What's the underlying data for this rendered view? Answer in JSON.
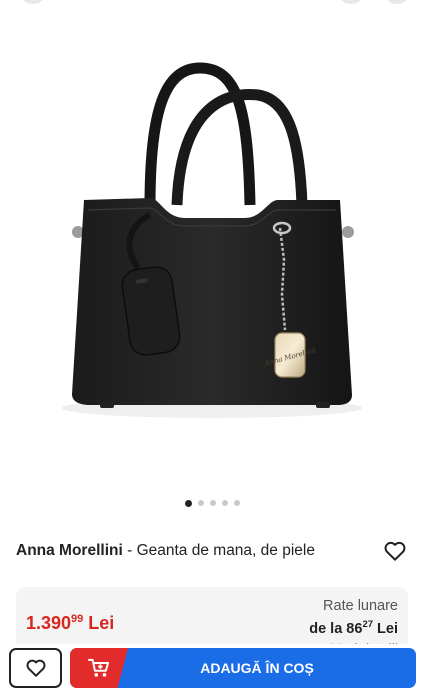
{
  "product": {
    "brand": "Anna Morellini",
    "separator": " - ",
    "name": "Geanta de mana, de piele",
    "image_icon": "handbag-product-photo",
    "charm_text": "Anna Morellini"
  },
  "gallery": {
    "total": 5,
    "active_index": 0
  },
  "price": {
    "main": "1.390",
    "decimals": "99",
    "currency": " Lei"
  },
  "installments": {
    "label": "Rate lunare",
    "prefix": "de la 86",
    "decimals": "27",
    "currency": " Lei",
    "details_link": "Vezi detalii"
  },
  "actions": {
    "favorite_icon": "heart-icon",
    "cart_icon": "cart-icon",
    "add_to_cart_label": "ADAUGĂ ÎN COȘ"
  },
  "colors": {
    "price_red": "#d7281f",
    "cart_red": "#e22b2b",
    "cart_blue": "#1a6de6"
  }
}
